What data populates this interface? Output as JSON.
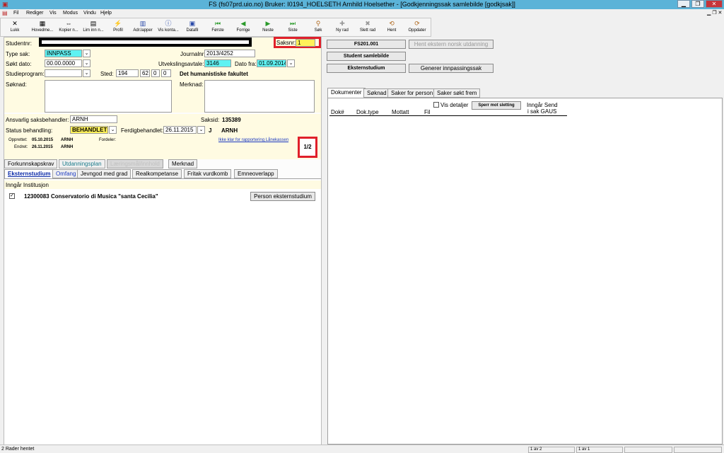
{
  "window": {
    "title": "FS (fs07prd.uio.no) Bruker: I0194_HOELSETH Arnhild Hoelsether - [Godkjenningssak samlebilde  [godkjsak]]",
    "min": "▁",
    "restore": "❐",
    "close": "✕"
  },
  "menu": [
    "Fil",
    "Rediger",
    "Vis",
    "Modus",
    "Vindu",
    "Hjelp"
  ],
  "toolbar": [
    {
      "label": "Lukk",
      "icon": "✕"
    },
    {
      "label": "Hovedme...",
      "icon": "▦"
    },
    {
      "label": "Kopier n...",
      "icon": "⇔"
    },
    {
      "label": "Lim inn n...",
      "icon": "▤"
    },
    {
      "label": "Profil",
      "icon": "⚡"
    },
    {
      "label": "Adr.lapper",
      "icon": "▥"
    },
    {
      "label": "Vis konta...",
      "icon": "ⓘ"
    },
    {
      "label": "Datafil",
      "icon": "▣"
    },
    {
      "label": "Første",
      "icon": "⏮"
    },
    {
      "label": "Forrige",
      "icon": "◀"
    },
    {
      "label": "Neste",
      "icon": "▶"
    },
    {
      "label": "Siste",
      "icon": "⏭"
    },
    {
      "label": "Søk",
      "icon": "⚲"
    },
    {
      "label": "Ny rad",
      "icon": "✚"
    },
    {
      "label": "Slett rad",
      "icon": "✖"
    },
    {
      "label": "Hent",
      "icon": "⟲"
    },
    {
      "label": "Oppdater",
      "icon": "⟳"
    }
  ],
  "form": {
    "studentnr_label": "Studentnr:",
    "saksnr_label": "Saksnr:",
    "saksnr_value": "1",
    "typesak_label": "Type sak:",
    "typesak_value": "INNPASS",
    "journalnr_label": "Journalnr:",
    "journalnr_value": "2013/4252",
    "soktdato_label": "Søkt dato:",
    "soktdato_value": "00.00.0000",
    "utveksling_label": "Utvekslingsavtale:",
    "utveksling_value": "3146",
    "datofra_label": "Dato fra:",
    "datofra_value": "01.09.2014",
    "studieprogram_label": "Studieprogram:",
    "sted_label": "Sted:",
    "sted_values": [
      "194",
      "62",
      "0",
      "0"
    ],
    "fakultet": "Det humanistiske fakultet",
    "soknad_label": "Søknad:",
    "merknad_label": "Merknad:",
    "ansvarlig_label": "Ansvarlig saksbehandler:",
    "ansvarlig_value": "ARNH",
    "saksid_label": "Saksid:",
    "saksid_value": "135389",
    "status_label": "Status behandling:",
    "status_value": "BEHANDLET",
    "ferdig_label": "Ferdigbehandlet:",
    "ferdig_value": "26.11.2015",
    "ferdig_flag": "J",
    "ferdig_user": "ARNH",
    "opprettet_label": "Opprettet:",
    "opprettet_value": "05.10.2015",
    "opprettet_user": "ARNH",
    "endret_label": "Endret:",
    "endret_value": "26.11.2015",
    "endret_user": "ARNH",
    "fordeler_label": "Fordeler:",
    "lanekassen_link": "Ikke klar for rapportering Lånekassen",
    "counter": "1/2"
  },
  "tabs_row1": [
    "Forkunnskapskrav",
    "Utdanningsplan",
    "Læringsmål/innhold",
    "Merknad"
  ],
  "tabs_row2": [
    "Eksternstudium",
    "Omfang",
    "Jevngod med grad",
    "Realkompetanse",
    "Fritak vurdkomb",
    "Emneoverlapp"
  ],
  "ekstern": {
    "header": "Inngår Institusjon",
    "row_code": "12300083",
    "row_name": "Conservatorio di Musica \"santa Cecilia\"",
    "person_button": "Person eksternstudium",
    "checkbox_mark": "✓"
  },
  "right_buttons": {
    "fs201": "FS201.001",
    "hent_ekstern": "Hent ekstern norsk utdanning",
    "student_samlebilde": "Student samlebilde",
    "eksternstudium": "Eksternstudium",
    "generer": "Generer innpassingssak"
  },
  "doc_tabs": [
    "Dokumenter",
    "Søknad",
    "Saker for person",
    "Saker søkt frem"
  ],
  "docs": {
    "vis_detaljer": "Vis detaljer",
    "sperr_button": "Sperr mot sletting",
    "inngar_send": "Inngår Send",
    "i_sak_gaus": "i sak GAUS",
    "columns": [
      "Dok#",
      "Dok.type",
      "Mottatt",
      "Fil"
    ]
  },
  "status": {
    "message": "2 Rader hentet",
    "seg1": "1 av 2",
    "seg2": "1 av 1"
  },
  "colors": {
    "titlebar": "#5bb3d8",
    "highlight_red": "#e0202a",
    "cyan_field": "#5ff2f2",
    "yellow_field": "#fff15a"
  }
}
